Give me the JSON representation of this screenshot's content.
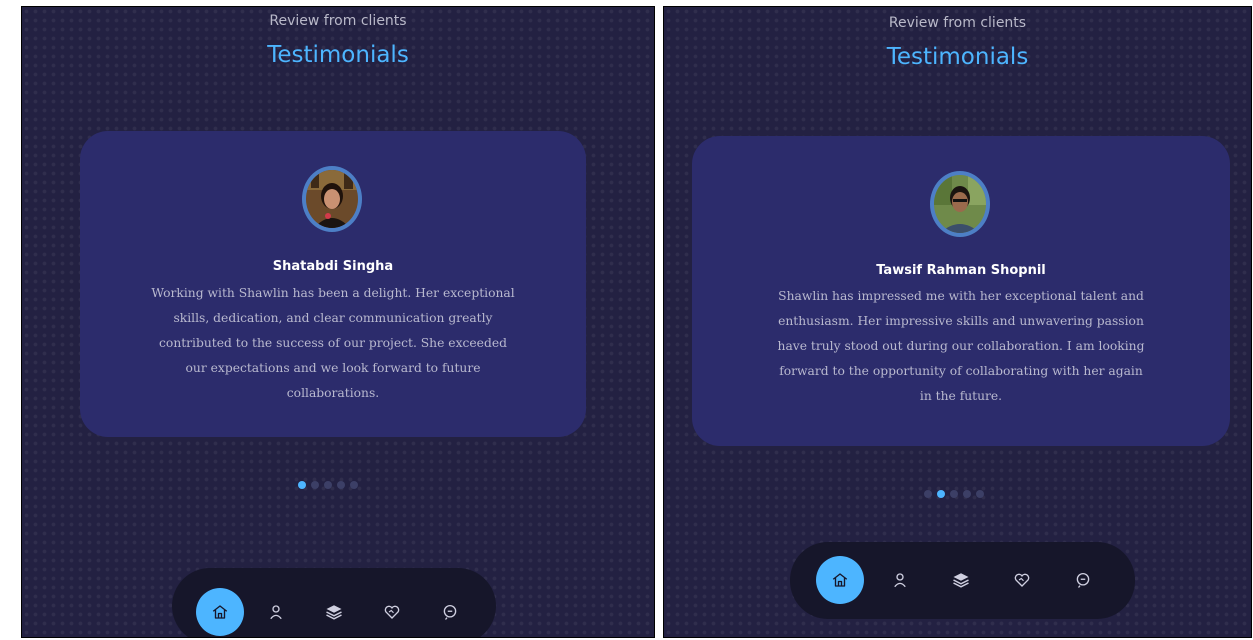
{
  "colors": {
    "background": "#232142",
    "card": "#2c2c6c",
    "accent": "#4db5ff",
    "nav": "#16162a",
    "text_muted": "#b9b9cf",
    "dot_inactive": "#3c3f66"
  },
  "panels": [
    {
      "subtitle": "Review from clients",
      "title": "Testimonials",
      "client_name": "Shatabdi Singha",
      "review_lines": [
        "Working with Shawlin has been a delight. Her exceptional",
        "skills, dedication, and clear communication greatly",
        "contributed to the success of our project. She exceeded",
        "our expectations and we look forward to future",
        "collaborations."
      ],
      "active_slide": 1,
      "slide_count": 5,
      "nav_items": [
        "home-icon",
        "user-icon",
        "layers-icon",
        "heart-handshake-icon",
        "message-icon"
      ],
      "nav_active": "home-icon"
    },
    {
      "subtitle": "Review from clients",
      "title": "Testimonials",
      "client_name": "Tawsif Rahman Shopnil",
      "review_lines": [
        "Shawlin has impressed me with her exceptional talent and",
        "enthusiasm. Her impressive skills and unwavering passion",
        "have truly stood out during our collaboration. I am looking",
        "forward to the opportunity of collaborating with her again",
        "in the future."
      ],
      "active_slide": 2,
      "slide_count": 5,
      "nav_items": [
        "home-icon",
        "user-icon",
        "layers-icon",
        "heart-handshake-icon",
        "message-icon"
      ],
      "nav_active": "home-icon"
    }
  ]
}
